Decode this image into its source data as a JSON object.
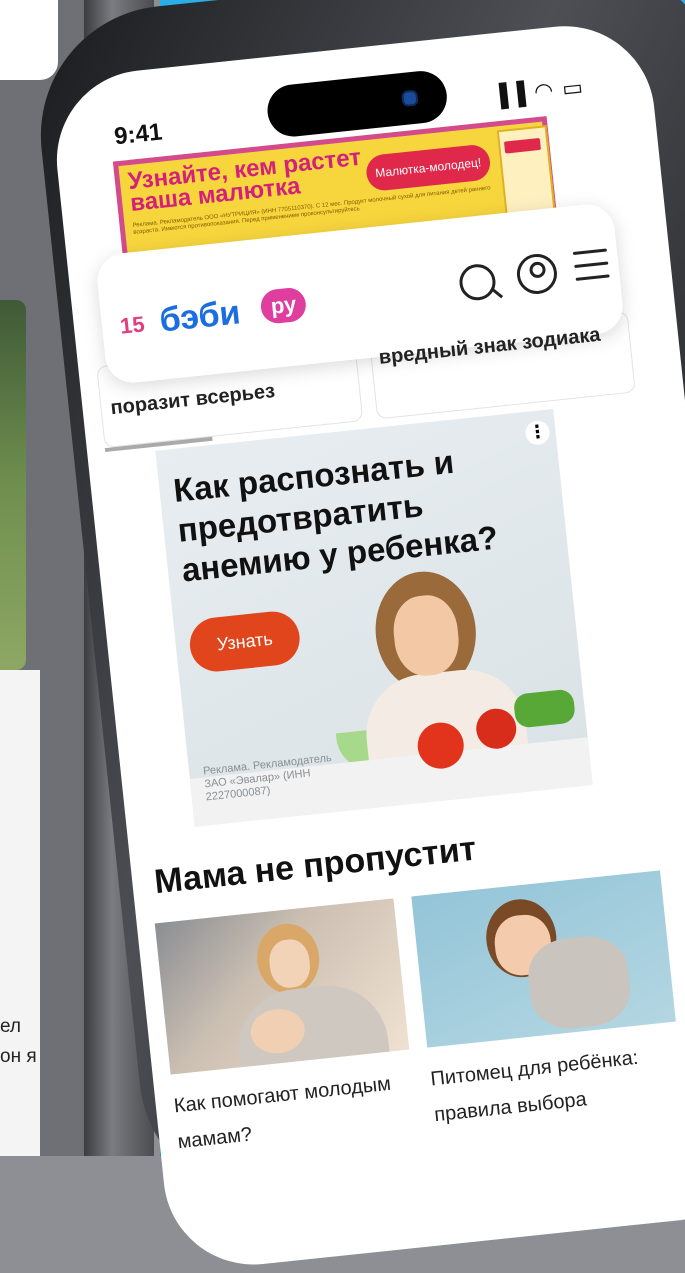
{
  "status_bar": {
    "time": "9:41",
    "icons": "▐▐ ◠ ▭"
  },
  "banner": {
    "headline": "Узнайте, кем растет ваша малютка",
    "button": "Малютка-молодец!",
    "fine_print": "Реклама. Рекламодатель ООО «НУТРИЦИЯ» (ИНН 7705110370). С 12 мес. Продукт молочный сухой для питания детей раннего возраста. Имеются противопоказания. Перед применением проконсультируйтесь"
  },
  "header": {
    "logo_number": "15",
    "logo_text": "бэби",
    "logo_suffix": "ру"
  },
  "articles_top": [
    {
      "title": "поразит всерьез"
    },
    {
      "title": "вредный знак зодиака"
    }
  ],
  "ad": {
    "title": "Как распознать и предотвратить анемию у ребенка?",
    "button": "Узнать",
    "menu": "⋮",
    "disclaimer": "Реклама. Рекламодатель ЗАО «Эвалар» (ИНН 2227000087)"
  },
  "section": {
    "title": "Мама не пропустит",
    "cards": [
      {
        "title": "Как помогают молодым мамам?"
      },
      {
        "title": "Питомец для ребёнка: правила выбора"
      }
    ]
  },
  "back_phone": {
    "text": "ел он я"
  }
}
